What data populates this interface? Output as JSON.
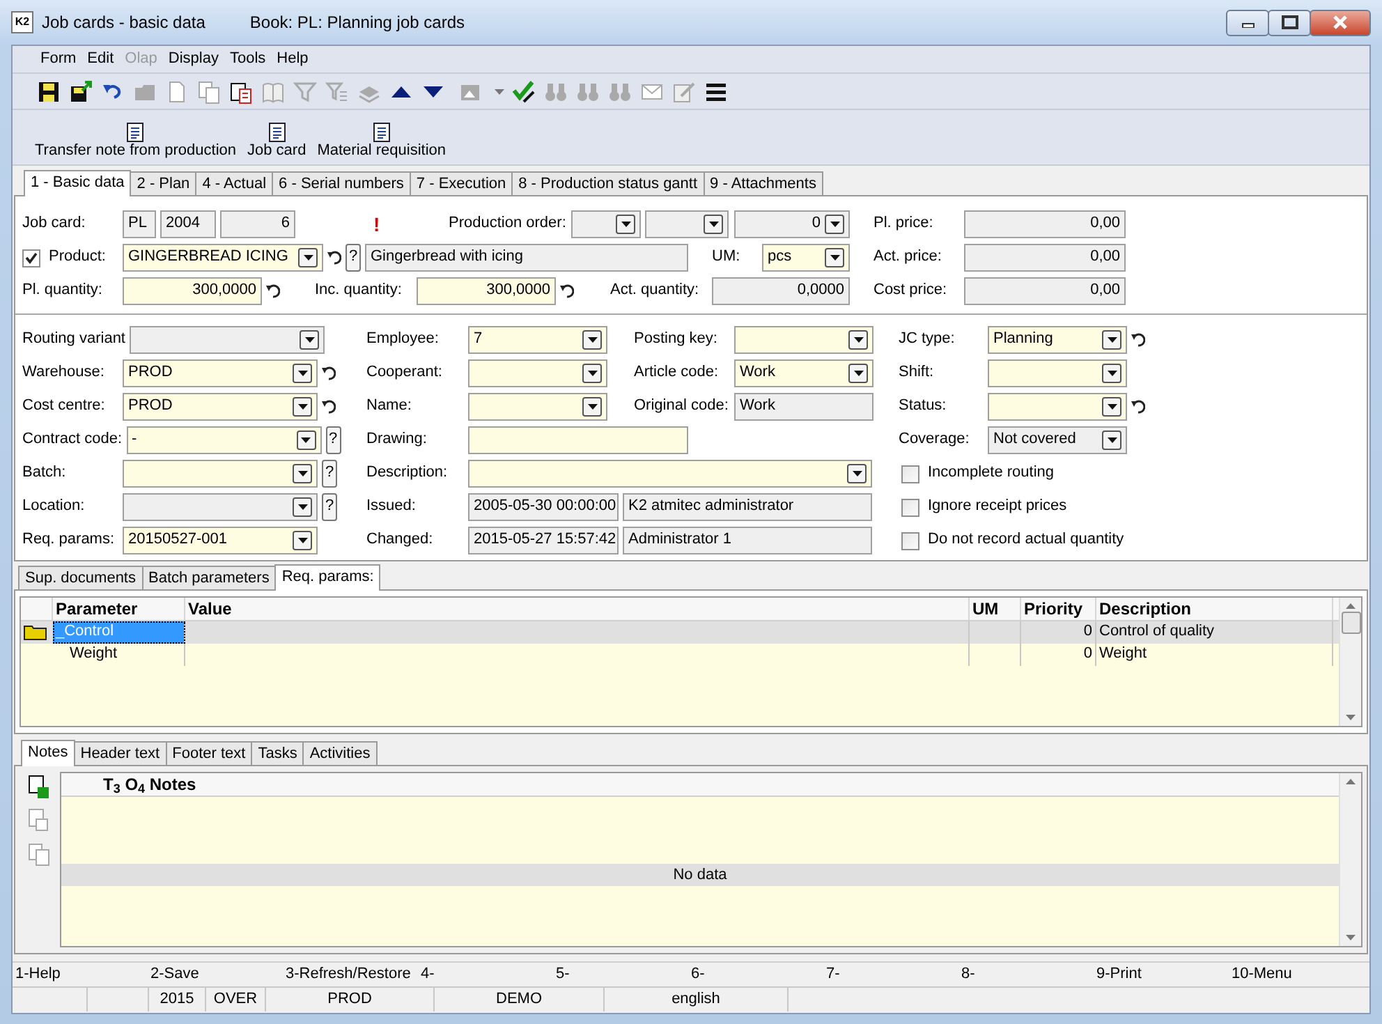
{
  "window": {
    "logo": "K2",
    "title": "Job cards - basic data",
    "book": "Book: PL: Planning job cards"
  },
  "menu": [
    {
      "label": "Form",
      "disabled": false
    },
    {
      "label": "Edit",
      "disabled": false
    },
    {
      "label": "Olap",
      "disabled": true
    },
    {
      "label": "Display",
      "disabled": false
    },
    {
      "label": "Tools",
      "disabled": false
    },
    {
      "label": "Help",
      "disabled": false
    }
  ],
  "toolbar": [
    {
      "kind": "save",
      "disabled": false
    },
    {
      "kind": "save-send",
      "disabled": false
    },
    {
      "kind": "undo",
      "disabled": false
    },
    {
      "kind": "open",
      "disabled": true
    },
    {
      "kind": "new",
      "disabled": true
    },
    {
      "kind": "copy",
      "disabled": true
    },
    {
      "kind": "paste",
      "disabled": false
    },
    {
      "kind": "book",
      "disabled": true
    },
    {
      "kind": "filter",
      "disabled": true
    },
    {
      "kind": "filter-list",
      "disabled": true
    },
    {
      "kind": "stack",
      "disabled": true
    },
    {
      "kind": "up",
      "disabled": false
    },
    {
      "kind": "down",
      "disabled": false
    },
    {
      "kind": "image-menu",
      "disabled": true
    },
    {
      "kind": "check-pen",
      "disabled": false
    },
    {
      "kind": "binoculars",
      "disabled": true
    },
    {
      "kind": "binoculars",
      "disabled": true
    },
    {
      "kind": "binoculars",
      "disabled": true
    },
    {
      "kind": "mail",
      "disabled": true
    },
    {
      "kind": "edit",
      "disabled": true
    },
    {
      "kind": "menu",
      "disabled": false
    }
  ],
  "actions": [
    "Transfer note from production",
    "Job card",
    "Material requisition"
  ],
  "tabs": [
    {
      "label": "1 - Basic data",
      "selected": true
    },
    {
      "label": "2 - Plan",
      "selected": false
    },
    {
      "label": "4 - Actual",
      "selected": false
    },
    {
      "label": "6 - Serial numbers",
      "selected": false
    },
    {
      "label": "7 - Execution",
      "selected": false
    },
    {
      "label": "8 - Production status gantt",
      "selected": false
    },
    {
      "label": "9 - Attachments",
      "selected": false
    }
  ],
  "header": {
    "job_card": [
      {
        "kind": "label",
        "text": "Job card:"
      },
      {
        "kind": "field",
        "value": "PL",
        "readonly": true
      },
      {
        "kind": "field",
        "value": "2004",
        "readonly": true
      },
      {
        "kind": "field",
        "value": "6",
        "readonly": true
      },
      {
        "kind": "warning",
        "text": "!"
      }
    ],
    "production_order": [
      {
        "kind": "label",
        "text": "Production order:"
      },
      {
        "kind": "combo",
        "readonly": true
      },
      {
        "kind": "combo",
        "readonly": true
      },
      {
        "kind": "combo",
        "value": "0",
        "readonly": true
      }
    ],
    "planned_price": [
      {
        "kind": "label",
        "text": "Pl. price:"
      },
      {
        "kind": "field",
        "value": "0,00",
        "readonly": true
      }
    ],
    "product": [
      {
        "kind": "check",
        "label": "Product:",
        "checked": true
      },
      {
        "kind": "combo",
        "value": "GINGERBREAD ICING",
        "readonly": false,
        "history": true,
        "help": "?"
      },
      {
        "kind": "field",
        "value": "Gingerbread with icing",
        "readonly": true
      }
    ],
    "unit": [
      {
        "kind": "label",
        "text": "UM:"
      },
      {
        "kind": "combo",
        "value": "pcs",
        "readonly": false
      }
    ],
    "actual_price": [
      {
        "kind": "label",
        "text": "Act. price:"
      },
      {
        "kind": "field",
        "value": "0,00",
        "readonly": true
      }
    ],
    "planned_quantity": [
      {
        "kind": "label",
        "text": "Pl. quantity:"
      },
      {
        "kind": "field",
        "value": "300,0000",
        "readonly": false,
        "history": true
      }
    ],
    "incoming_quantity": [
      {
        "kind": "label",
        "text": "Inc. quantity:"
      },
      {
        "kind": "field",
        "value": "300,0000",
        "readonly": false,
        "history": true
      }
    ],
    "actual_quantity": [
      {
        "kind": "label",
        "text": "Act. quantity:"
      },
      {
        "kind": "field",
        "value": "0,0000",
        "readonly": true
      }
    ],
    "cost_price": [
      {
        "kind": "label",
        "text": "Cost price:"
      },
      {
        "kind": "field",
        "value": "0,00",
        "readonly": true
      }
    ]
  },
  "details": {
    "rows": [
      [
        {
          "kind": "label",
          "text": "Routing variant"
        },
        {
          "kind": "combo",
          "readonly": true
        },
        {
          "kind": "label",
          "text": "Employee:"
        },
        {
          "kind": "combo",
          "value": "7",
          "readonly": false
        },
        {
          "kind": "label",
          "text": "Posting key:"
        },
        {
          "kind": "combo",
          "readonly": false
        },
        {
          "kind": "label",
          "text": "JC type:"
        },
        {
          "kind": "combo",
          "value": "Planning",
          "readonly": false,
          "history": true
        }
      ],
      [
        {
          "kind": "label",
          "text": "Warehouse:"
        },
        {
          "kind": "combo",
          "value": "PROD",
          "readonly": false,
          "history": true
        },
        {
          "kind": "label",
          "text": "Cooperant:"
        },
        {
          "kind": "combo",
          "readonly": false
        },
        {
          "kind": "label",
          "text": "Article code:"
        },
        {
          "kind": "combo",
          "value": "Work",
          "readonly": false
        },
        {
          "kind": "label",
          "text": "Shift:"
        },
        {
          "kind": "combo",
          "readonly": false
        }
      ],
      [
        {
          "kind": "label",
          "text": "Cost centre:"
        },
        {
          "kind": "combo",
          "value": "PROD",
          "readonly": false,
          "history": true
        },
        {
          "kind": "label",
          "text": "Name:"
        },
        {
          "kind": "combo",
          "readonly": false
        },
        {
          "kind": "label",
          "text": "Original code:"
        },
        {
          "kind": "field",
          "value": "Work",
          "readonly": true
        },
        {
          "kind": "label",
          "text": "Status:"
        },
        {
          "kind": "combo",
          "readonly": false,
          "history": true
        }
      ],
      [
        {
          "kind": "label",
          "text": "Contract code:"
        },
        {
          "kind": "combo",
          "value": "-",
          "readonly": false,
          "help": "?"
        },
        {
          "kind": "label",
          "text": "Drawing:"
        },
        {
          "kind": "field",
          "readonly": false
        },
        {
          "kind": "label",
          "text": "Coverage:"
        },
        {
          "kind": "combo",
          "value": "Not covered",
          "readonly": true
        }
      ],
      [
        {
          "kind": "label",
          "text": "Batch:"
        },
        {
          "kind": "combo",
          "readonly": false,
          "help": "?"
        },
        {
          "kind": "label",
          "text": "Description:"
        },
        {
          "kind": "combo",
          "readonly": false
        },
        {
          "kind": "check",
          "label": "Incomplete routing",
          "checked": false
        }
      ],
      [
        {
          "kind": "label",
          "text": "Location:"
        },
        {
          "kind": "combo",
          "readonly": true,
          "help": "?"
        },
        {
          "kind": "label",
          "text": "Issued:"
        },
        {
          "kind": "field",
          "value": "2005-05-30 00:00:00",
          "readonly": true
        },
        {
          "kind": "field",
          "value": "K2 atmitec administrator",
          "readonly": true
        },
        {
          "kind": "check",
          "label": "Ignore receipt prices",
          "checked": false
        }
      ],
      [
        {
          "kind": "label",
          "text": "Req. params:"
        },
        {
          "kind": "combo",
          "value": "20150527-001",
          "readonly": false
        },
        {
          "kind": "label",
          "text": "Changed:"
        },
        {
          "kind": "field",
          "value": "2015-05-27 15:57:42",
          "readonly": true
        },
        {
          "kind": "field",
          "value": "Administrator 1",
          "readonly": true
        },
        {
          "kind": "check",
          "label": "Do not record actual quantity",
          "checked": false
        }
      ]
    ]
  },
  "params": {
    "tabs": [
      {
        "label": "Sup. documents",
        "selected": false
      },
      {
        "label": "Batch parameters",
        "selected": false
      },
      {
        "label": "Req. params:",
        "selected": true
      }
    ],
    "columns": [
      "Parameter",
      "Value",
      "UM",
      "Priority",
      "Description"
    ],
    "rows": [
      {
        "parameter": "_Control",
        "priority": "0",
        "description": "Control of quality",
        "selected": true,
        "children": [
          {
            "parameter": "Weight",
            "priority": "0",
            "description": "Weight",
            "selected": false
          }
        ]
      }
    ]
  },
  "notes": {
    "tabs": [
      {
        "label": "Notes",
        "selected": true
      },
      {
        "label": "Header text",
        "selected": false
      },
      {
        "label": "Footer text",
        "selected": false
      },
      {
        "label": "Tasks",
        "selected": false
      },
      {
        "label": "Activities",
        "selected": false
      }
    ],
    "tools": [
      {
        "kind": "add",
        "disabled": false
      },
      {
        "kind": "edit",
        "disabled": true
      },
      {
        "kind": "copy",
        "disabled": true
      }
    ],
    "header": "T$_{3}$ O$_{4}$ Notes",
    "empty_text": "No data"
  },
  "function_keys": [
    "1-Help",
    "2-Save",
    "3-Refresh/Restore",
    "4-",
    "5-",
    "6-",
    "7-",
    "8-",
    "9-Print",
    "10-Menu"
  ],
  "status_bar": [
    "2015",
    "OVER",
    "PROD",
    "DEMO",
    "english"
  ]
}
